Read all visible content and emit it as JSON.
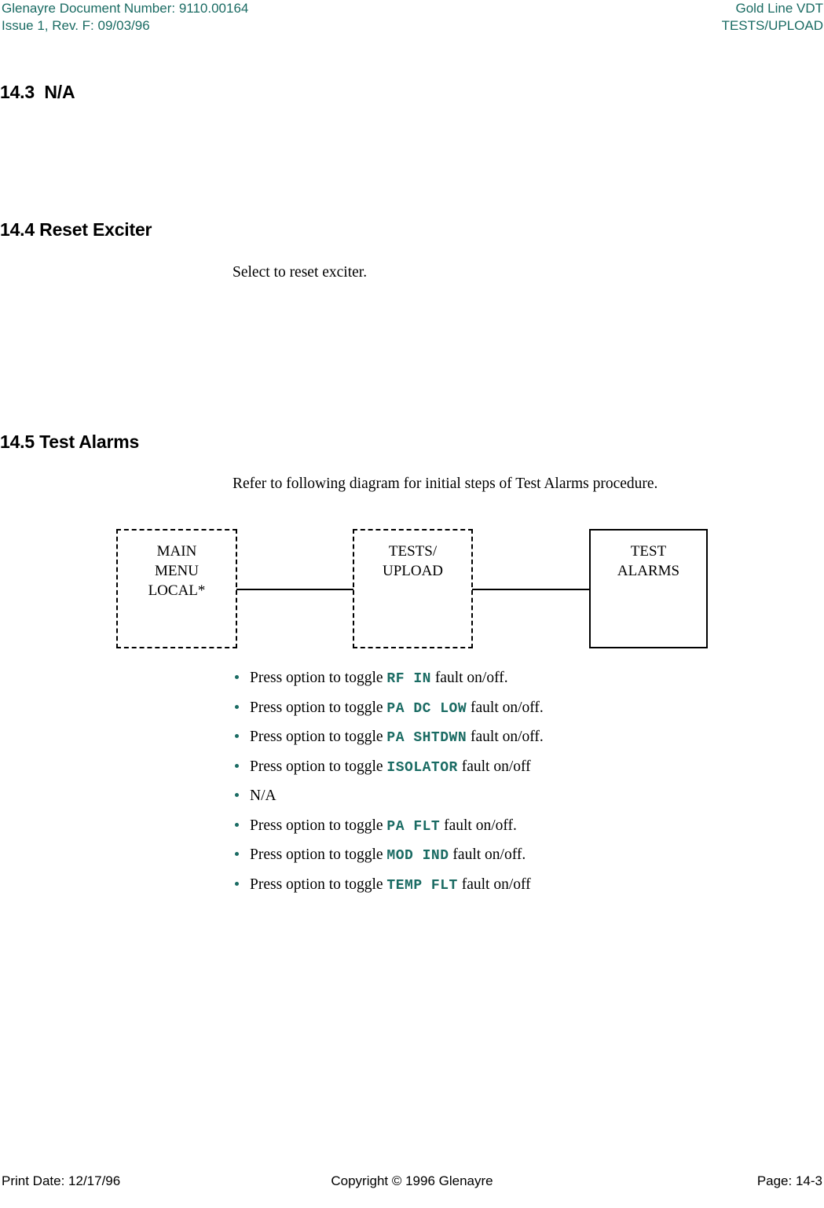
{
  "header": {
    "left_line1": "Glenayre Document Number: 9110.00164",
    "left_line2": "Issue 1, Rev. F: 09/03/96",
    "right_line1": "Gold Line VDT",
    "right_line2": "TESTS/UPLOAD",
    "color": "#1a6b63"
  },
  "sections": {
    "s143": {
      "heading": "14.3  N/A"
    },
    "s144": {
      "heading": "14.4 Reset Exciter",
      "body": "Select to reset exciter."
    },
    "s145": {
      "heading": "14.5 Test Alarms",
      "body": "Refer to following diagram for initial steps of Test Alarms procedure."
    }
  },
  "diagram": {
    "boxes": [
      {
        "label": "MAIN\nMENU\nLOCAL*",
        "style": "dashed"
      },
      {
        "label": "TESTS/\nUPLOAD",
        "style": "dashed"
      },
      {
        "label": "TEST\nALARMS",
        "style": "solid"
      }
    ]
  },
  "bullets": [
    {
      "pre": "Press option to toggle ",
      "code": "RF IN",
      "post": "  fault on/off."
    },
    {
      "pre": "Press option to toggle ",
      "code": "PA DC LOW",
      "post": "  fault on/off."
    },
    {
      "pre": "Press option to toggle ",
      "code": "PA SHTDWN",
      "post": " fault on/off."
    },
    {
      "pre": "Press option to toggle ",
      "code": "ISOLATOR",
      "post": "  fault on/off"
    },
    {
      "pre": "N/A",
      "code": "",
      "post": ""
    },
    {
      "pre": "Press option to toggle ",
      "code": "PA FLT",
      "post": " fault on/off."
    },
    {
      "pre": "Press option to toggle ",
      "code": "MOD IND",
      "post": "  fault on/off."
    },
    {
      "pre": "Press option to toggle ",
      "code": "TEMP FLT",
      "post": "  fault on/off"
    }
  ],
  "footer": {
    "print_date": "Print Date: 12/17/96",
    "copyright": "Copyright © 1996 Glenayre",
    "page": "Page: 14-3"
  }
}
